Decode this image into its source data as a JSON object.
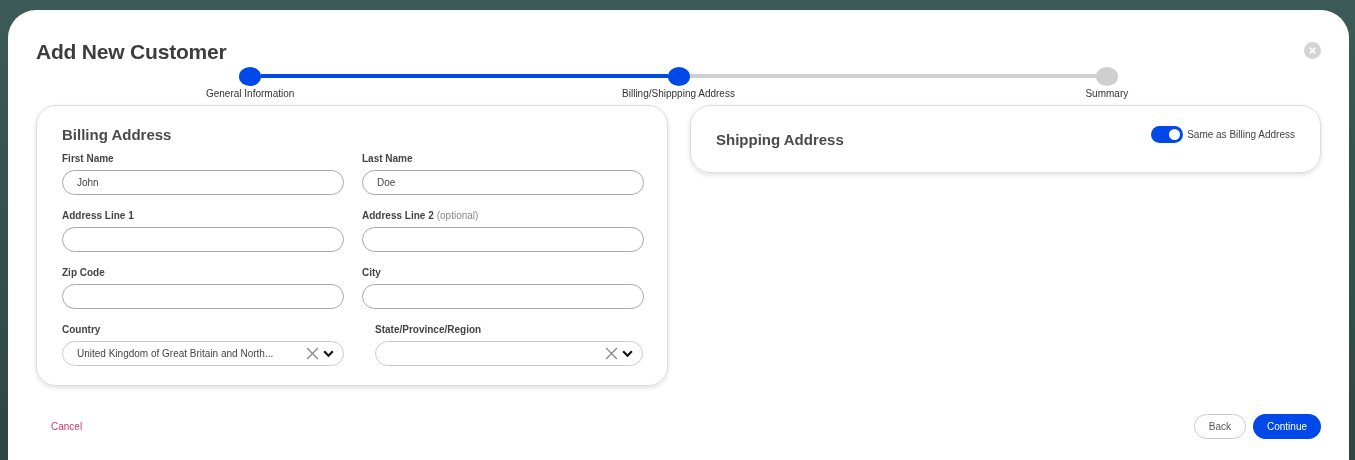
{
  "dialog": {
    "title": "Add New Customer"
  },
  "steps": [
    {
      "label": "General Information",
      "completed": true
    },
    {
      "label": "Billing/Shippping Address",
      "completed": true
    },
    {
      "label": "Summary",
      "completed": false
    }
  ],
  "billing": {
    "title": "Billing Address",
    "fields": [
      {
        "kind": "text",
        "label": "First Name",
        "value": "John"
      },
      {
        "kind": "text",
        "label": "Last Name",
        "value": "Doe"
      },
      {
        "kind": "text",
        "label": "Address Line 1"
      },
      {
        "kind": "text",
        "label": "Address Line 2",
        "hint": "(optional)"
      },
      {
        "kind": "text",
        "label": "Zip Code"
      },
      {
        "kind": "text",
        "label": "City"
      },
      {
        "kind": "select",
        "label": "Country",
        "value": "United Kingdom of Great Britain and North..."
      },
      {
        "kind": "select",
        "label": "State/Province/Region"
      }
    ]
  },
  "shipping": {
    "title": "Shipping Address",
    "toggle": {
      "label": "Same as Billing Address",
      "on": true
    }
  },
  "footer": {
    "cancel": "Cancel",
    "back": "Back",
    "continue": "Continue"
  }
}
